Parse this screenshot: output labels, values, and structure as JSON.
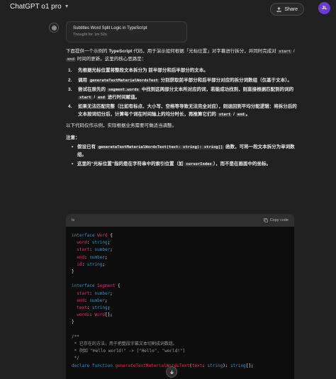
{
  "header": {
    "model_name": "ChatGPT o1 pro",
    "share_label": "Share",
    "avatar_initials": "JL"
  },
  "thought": {
    "title": "Subtitles Word Split Logic in TypeScript",
    "time": "Thought for 1m 52s"
  },
  "intro": {
    "a": "下面提供一个示例的 ",
    "b": "TypeScript",
    "c": " 代码，用于演示如何根据「光标位置」对字幕进行拆分，并同时完成对 ",
    "code1": "start",
    "d": " / ",
    "code2": "end",
    "e": " 时间的更新。这里的核心思路是："
  },
  "steps": [
    {
      "num": "1.",
      "text": "先根据光标位置将整段文本拆分为 前半部分和后半部分的文本。"
    },
    {
      "num": "2.",
      "a": "调用 ",
      "code": "generateTextMaterialWordsText",
      "b": " 分别获取前半部分和后半部分对应的拆分词数组（仅基于文本）。"
    },
    {
      "num": "3.",
      "a": "尝试在原先的 ",
      "code1": "segment.words",
      "b": " 中找到这两部分文本所对应的词，若能成功找到，则直接根据匹配到的词的 ",
      "code2": "start",
      "c": " / ",
      "code3": "end",
      "d": " 进行时间赋值。"
    },
    {
      "num": "4.",
      "a": "如果无法匹配完整（比如有标点、大小写、空格等导致无法完全对应），则退回到平均分配逻辑：将拆分后的文本按词切分后，计算每个词在时间轴上的均分时长，再推算它们的 ",
      "code1": "start",
      "b": " / ",
      "code2": "end",
      "c": "。"
    }
  ],
  "summary": "以下代码仅作示例，实际根据业务需要可做适当调整。",
  "notes": {
    "title": "注意：",
    "items": [
      {
        "a": "假设已有 ",
        "code": "generateTextMaterialWordsText(text: string): string[]",
        "b": " 函数，可将一段文本拆分为单词数组。"
      },
      {
        "a": "这里的“光标位置”指的是在字符串中的索引位置（如 ",
        "code": "cursorIndex",
        "b": "），而不是在画面中的坐标。"
      }
    ]
  },
  "code_block": {
    "language": "ts",
    "copy_label": "Copy code"
  }
}
